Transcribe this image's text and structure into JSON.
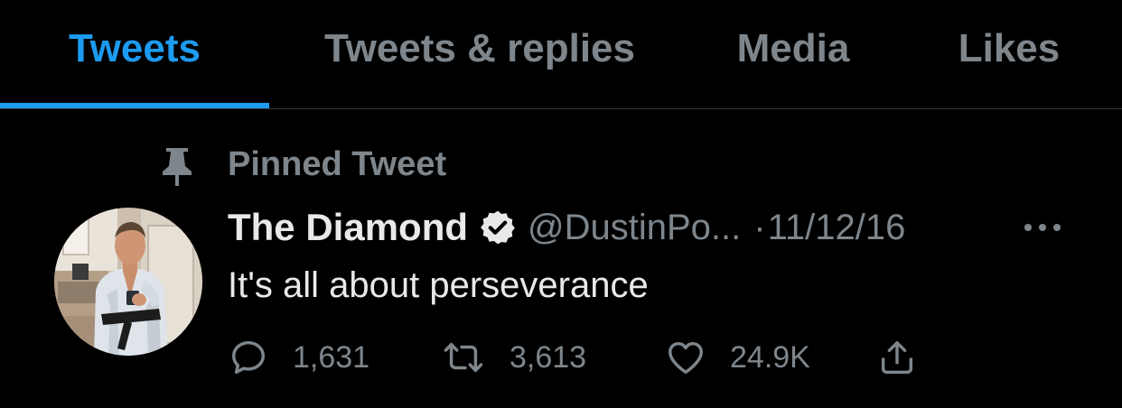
{
  "tabs": [
    {
      "label": "Tweets",
      "active": true
    },
    {
      "label": "Tweets & replies",
      "active": false
    },
    {
      "label": "Media",
      "active": false
    },
    {
      "label": "Likes",
      "active": false
    }
  ],
  "pinned": {
    "label": "Pinned Tweet",
    "icon": "pin-icon"
  },
  "tweet": {
    "display_name": "The Diamond",
    "verified": true,
    "handle": "@DustinPo...",
    "separator": "·",
    "date": "11/12/16",
    "text": "It's all about perseverance",
    "actions": {
      "reply_count": "1,631",
      "retweet_count": "3,613",
      "like_count": "24.9K"
    }
  },
  "colors": {
    "background": "#000000",
    "accent": "#1d9bf0",
    "primary_text": "#e7e9ea",
    "secondary_text": "#7e868c",
    "divider": "#2f3336"
  }
}
